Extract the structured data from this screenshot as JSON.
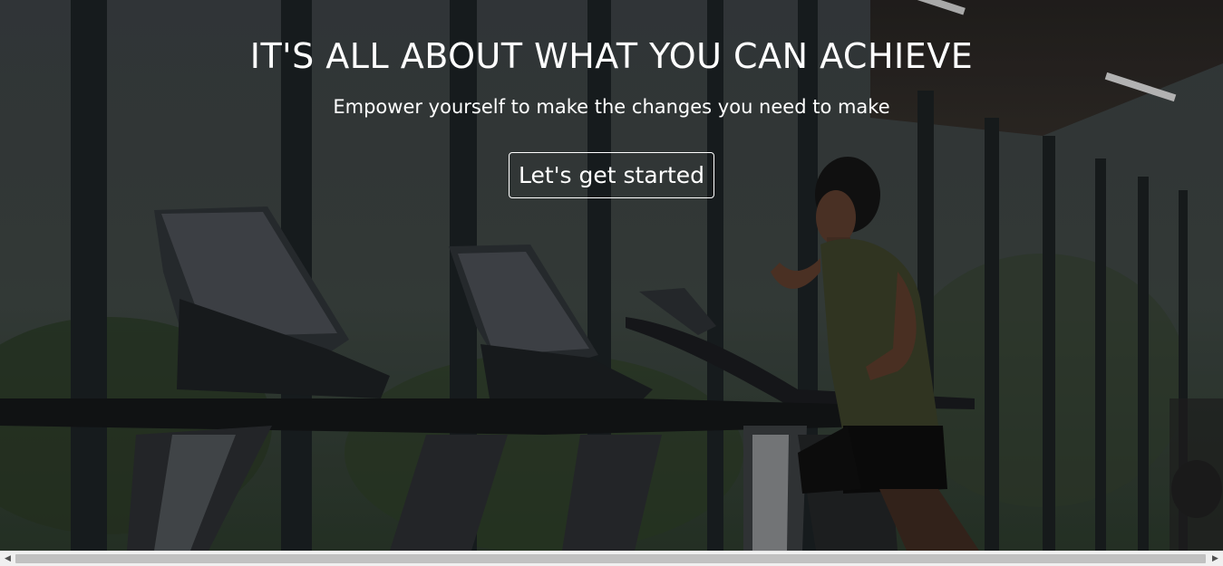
{
  "hero": {
    "title": "IT'S ALL ABOUT WHAT YOU CAN ACHIEVE",
    "subtitle": "Empower yourself to make the changes you need to make",
    "cta_label": "Let's get started",
    "background_image": "gym-treadmills-runner-photo",
    "text_color": "#ffffff"
  },
  "scrollbar": {
    "left_arrow": "◀",
    "right_arrow": "▶",
    "thumb_position": 0
  }
}
